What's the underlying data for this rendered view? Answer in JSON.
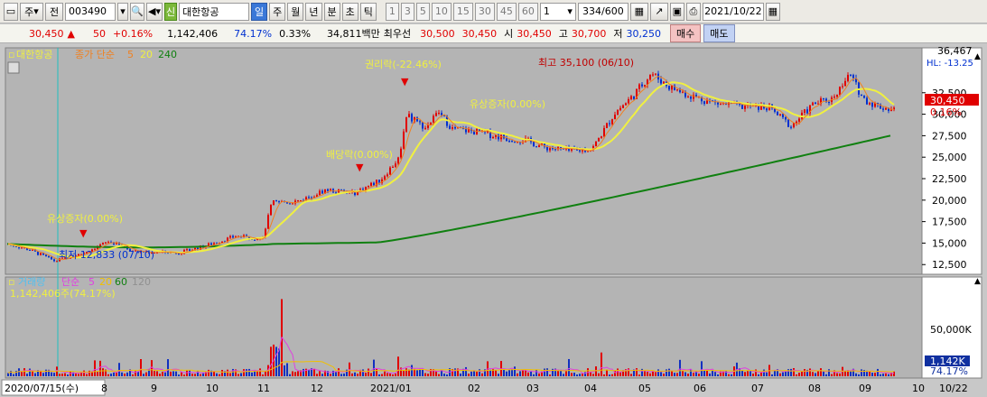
{
  "toolbar": {
    "period_select": "주",
    "prev_label": "전",
    "code": "003490",
    "name_badge": "신",
    "name": "대한항공",
    "periods": [
      "일",
      "주",
      "월",
      "년",
      "분",
      "초",
      "틱"
    ],
    "minute_intervals": [
      "1",
      "3",
      "5",
      "10",
      "15",
      "30",
      "45",
      "60"
    ],
    "multiplier": "1",
    "count": "334/600",
    "date": "2021/10/22"
  },
  "quote": {
    "price": "30,450",
    "change_arrow": "▲",
    "change": "50",
    "change_pct": "+0.16%",
    "volume": "1,142,406",
    "volume_ratio": "74.17%",
    "turnover_pct": "0.33%",
    "value": "34,811백만",
    "prior_high_label": "최우선",
    "bid1": "30,500",
    "ask1": "30,450",
    "open_label": "시",
    "open": "30,450",
    "high_label": "고",
    "high": "30,700",
    "low_label": "저",
    "low": "30,250",
    "buy_label": "매수",
    "sell_label": "매도"
  },
  "price_legend": {
    "name": "대한항공",
    "ma_label": "종가 단순",
    "ma_periods": [
      "5",
      "20",
      "240"
    ]
  },
  "volume_legend": {
    "name": "거래량",
    "ma_label": "단순",
    "ma_periods": [
      "5",
      "20",
      "60",
      "120"
    ],
    "current": "1,142,406주(74.17%)"
  },
  "annotations": {
    "rights_issue_1": "유상증자(0.00%)",
    "low": "최저 12,833 (07/10)",
    "dividend": "배당락(0.00%)",
    "rights_drop": "권리락(-22.46%)",
    "rights_issue_2": "유상증자(0.00%)",
    "high": "최고 35,100 (06/10)"
  },
  "price_axis": {
    "ticks": [
      "32,500",
      "30,000",
      "27,500",
      "25,000",
      "22,500",
      "20,000",
      "17,500",
      "15,000",
      "12,500"
    ],
    "top_value": "36,467",
    "current_tag": "30,450",
    "current_pct": "0.16%",
    "sub_tag": "HL: -13.25"
  },
  "volume_axis": {
    "tick": "50,000K",
    "current_tag": "1,142K",
    "current_pct": "74.17%"
  },
  "x_axis": {
    "crosshair_date": "2020/07/15(수)",
    "labels": [
      "8",
      "9",
      "10",
      "11",
      "12",
      "2021/01",
      "02",
      "03",
      "04",
      "05",
      "06",
      "07",
      "08",
      "09",
      "10",
      "10/22"
    ]
  },
  "colors": {
    "up": "#e00000",
    "down": "#0030d0",
    "ma5": "#f08020",
    "ma20": "#f0f040",
    "ma240": "#108010",
    "bg": "#b4b4b4"
  }
}
